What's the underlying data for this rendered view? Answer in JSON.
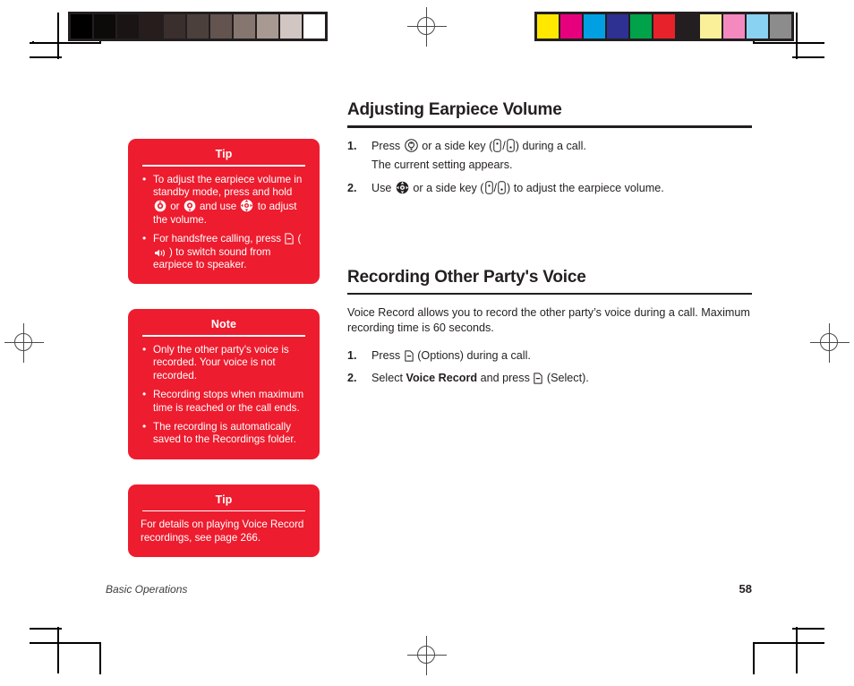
{
  "print_marks": {
    "grayscale_strip": {
      "label": "grayscale-calibration-strip",
      "swatches": [
        "#000000",
        "#0d0a0a",
        "#1a1414",
        "#261d1c",
        "#3a2f2d",
        "#4c403d",
        "#63544f",
        "#85766f",
        "#a89a93",
        "#d2c6c2",
        "#ffffff"
      ]
    },
    "color_strip": {
      "label": "color-calibration-strip",
      "swatches": [
        "#ffe800",
        "#e6007e",
        "#00a0e3",
        "#2e3192",
        "#00a24a",
        "#e8222a",
        "#231f20",
        "#fbf09a",
        "#f489c0",
        "#8ad2f2",
        "#8c8c8c"
      ]
    }
  },
  "sidebar": {
    "callouts": [
      {
        "title": "Tip",
        "type": "bulleted",
        "items": [
          {
            "segments": [
              {
                "kind": "text",
                "value": "To adjust the earpiece volume in standby mode, press and hold "
              },
              {
                "kind": "icon",
                "value": "volume-up-key-icon"
              },
              {
                "kind": "text",
                "value": " or "
              },
              {
                "kind": "icon",
                "value": "volume-down-key-icon"
              },
              {
                "kind": "text",
                "value": " and use "
              },
              {
                "kind": "icon",
                "value": "navigation-pad-icon"
              },
              {
                "kind": "text",
                "value": " to adjust the volume."
              }
            ]
          },
          {
            "segments": [
              {
                "kind": "text",
                "value": "For handsfree calling, press "
              },
              {
                "kind": "icon",
                "value": "left-softkey-icon"
              },
              {
                "kind": "text",
                "value": " ("
              },
              {
                "kind": "icon",
                "value": "speaker-icon"
              },
              {
                "kind": "text",
                "value": ") to switch sound from earpiece to speaker."
              }
            ]
          }
        ]
      },
      {
        "title": "Note",
        "type": "bulleted",
        "items": [
          {
            "segments": [
              {
                "kind": "text",
                "value": "Only the other party's voice is recorded. Your voice is not recorded."
              }
            ]
          },
          {
            "segments": [
              {
                "kind": "text",
                "value": "Recording stops when maximum time is reached or the call ends."
              }
            ]
          },
          {
            "segments": [
              {
                "kind": "text",
                "value": "The recording is automatically saved to the Recordings folder."
              }
            ]
          }
        ]
      },
      {
        "title": "Tip",
        "type": "plain",
        "items": [
          {
            "segments": [
              {
                "kind": "text",
                "value": "For details on playing Voice Record recordings, see page 266."
              }
            ]
          }
        ]
      }
    ]
  },
  "main": {
    "sections": [
      {
        "heading": "Adjusting Earpiece Volume",
        "intro": null,
        "blocks": [
          {
            "kind": "step",
            "number": "1.",
            "segments": [
              {
                "kind": "text",
                "value": "Press "
              },
              {
                "kind": "icon",
                "value": "volume-key-icon"
              },
              {
                "kind": "text",
                "value": " or a side key ("
              },
              {
                "kind": "icon",
                "value": "side-key-up-icon"
              },
              {
                "kind": "text",
                "value": "/"
              },
              {
                "kind": "icon",
                "value": "side-key-down-icon"
              },
              {
                "kind": "text",
                "value": ") during a call."
              }
            ]
          },
          {
            "kind": "substep",
            "segments": [
              {
                "kind": "text",
                "value": "The current setting appears."
              }
            ]
          },
          {
            "kind": "step",
            "number": "2.",
            "segments": [
              {
                "kind": "text",
                "value": "Use "
              },
              {
                "kind": "icon",
                "value": "navigation-pad-icon"
              },
              {
                "kind": "text",
                "value": " or a side key ("
              },
              {
                "kind": "icon",
                "value": "side-key-up-icon"
              },
              {
                "kind": "text",
                "value": "/"
              },
              {
                "kind": "icon",
                "value": "side-key-down-icon"
              },
              {
                "kind": "text",
                "value": ") to adjust the earpiece volume."
              }
            ]
          }
        ]
      },
      {
        "heading": "Recording Other Party's Voice",
        "intro": "Voice Record allows you to record the other party’s voice during a call. Maximum recording time is 60 seconds.",
        "blocks": [
          {
            "kind": "step",
            "number": "1.",
            "segments": [
              {
                "kind": "text",
                "value": "Press "
              },
              {
                "kind": "icon",
                "value": "left-softkey-icon"
              },
              {
                "kind": "text",
                "value": " (Options) during a call."
              }
            ]
          },
          {
            "kind": "step",
            "number": "2.",
            "segments": [
              {
                "kind": "text",
                "value": "Select "
              },
              {
                "kind": "bold",
                "value": "Voice Record"
              },
              {
                "kind": "text",
                "value": " and press "
              },
              {
                "kind": "icon",
                "value": "left-softkey-icon"
              },
              {
                "kind": "text",
                "value": " (Select)."
              }
            ]
          }
        ]
      }
    ]
  },
  "footer": {
    "chapter": "Basic Operations",
    "page_number": "58"
  },
  "colors": {
    "callout_red": "#ED1C2E",
    "text_black": "#231f20",
    "rule_black": "#231f20"
  }
}
